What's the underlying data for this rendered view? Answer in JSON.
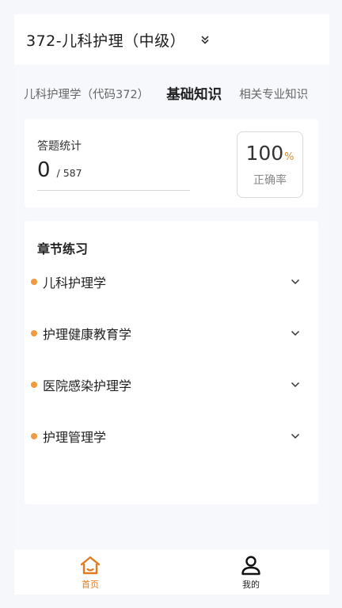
{
  "header": {
    "title": "372-儿科护理（中级）"
  },
  "tabs": [
    {
      "label": "儿科护理学（代码372）"
    },
    {
      "label": "基础知识"
    },
    {
      "label": "相关专业知识"
    }
  ],
  "stats": {
    "label": "答题统计",
    "answered": "0",
    "total": "/ 587",
    "rate_value": "100",
    "rate_unit": "%",
    "rate_label": "正确率"
  },
  "chapters": {
    "title": "章节练习",
    "items": [
      {
        "label": "儿科护理学"
      },
      {
        "label": "护理健康教育学"
      },
      {
        "label": "医院感染护理学"
      },
      {
        "label": "护理管理学"
      }
    ]
  },
  "nav": {
    "home_label": "首页",
    "mine_label": "我的"
  },
  "colors": {
    "accent": "#e07a1f",
    "dot": "#f29a3f"
  }
}
